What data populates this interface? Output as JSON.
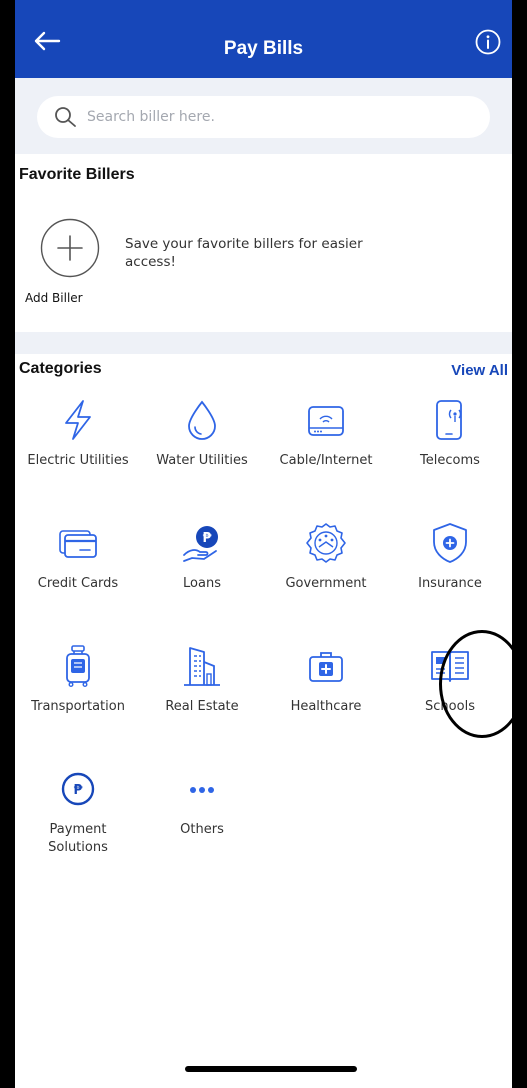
{
  "header": {
    "title": "Pay Bills",
    "back_icon": "arrow-left-icon",
    "info_icon": "info-icon"
  },
  "search": {
    "placeholder": "Search biller here.",
    "value": ""
  },
  "favorites": {
    "title": "Favorite Billers",
    "add_label": "Add Biller",
    "hint": "Save your favorite billers for easier access!"
  },
  "categories": {
    "title": "Categories",
    "view_all": "View All",
    "items": [
      {
        "label": "Electric Utilities",
        "icon": "lightning-icon"
      },
      {
        "label": "Water Utilities",
        "icon": "water-drop-icon"
      },
      {
        "label": "Cable/Internet",
        "icon": "router-icon"
      },
      {
        "label": "Telecoms",
        "icon": "phone-signal-icon"
      },
      {
        "label": "Credit Cards",
        "icon": "credit-card-icon"
      },
      {
        "label": "Loans",
        "icon": "loan-hand-icon"
      },
      {
        "label": "Government",
        "icon": "government-seal-icon"
      },
      {
        "label": "Insurance",
        "icon": "shield-icon"
      },
      {
        "label": "Transportation",
        "icon": "luggage-icon"
      },
      {
        "label": "Real Estate",
        "icon": "building-icon"
      },
      {
        "label": "Healthcare",
        "icon": "medical-kit-icon"
      },
      {
        "label": "Schools",
        "icon": "book-icon"
      },
      {
        "label": "Payment Solutions",
        "icon": "peso-coin-icon"
      },
      {
        "label": "Others",
        "icon": "more-dots-icon"
      }
    ]
  },
  "colors": {
    "primary": "#1747b9",
    "surface": "#eef1f7",
    "accent": "#2f65e6"
  }
}
